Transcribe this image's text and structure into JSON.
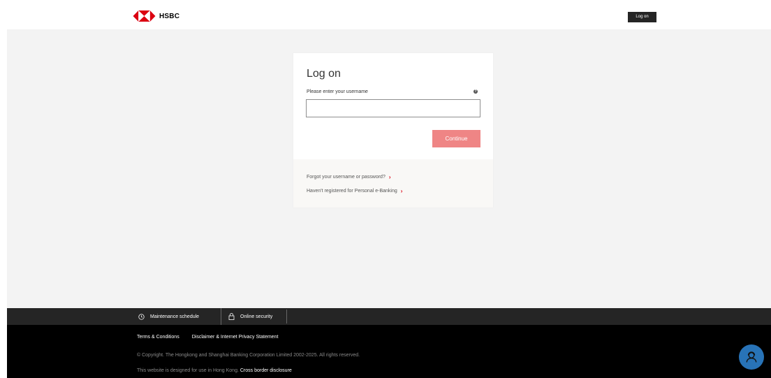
{
  "header": {
    "brand": "HSBC",
    "logon_button": "Log on"
  },
  "card": {
    "title": "Log on",
    "username_label": "Please enter your username",
    "help_icon": "?",
    "username_value": "",
    "continue_label": "Continue",
    "links": [
      {
        "label": "Forgot your username or password?",
        "icon": "chevron-right-icon"
      },
      {
        "label": "Haven't registered for Personal e-Banking",
        "icon": "chevron-right-icon"
      }
    ]
  },
  "footer": {
    "top_items": [
      {
        "label": "Maintenance schedule",
        "icon": "clock-icon"
      },
      {
        "label": "Online security",
        "icon": "lock-icon"
      }
    ],
    "links": [
      "Terms & Conditions",
      "Disclaimer & Internet Privacy Statement"
    ],
    "copyright": "© Copyright. The Hongkong and Shanghai Banking Corporation Limited 2002-2025. All rights reserved.",
    "site_note": "This website is designed for use in Hong Kong.",
    "site_link": "Cross border disclosure"
  },
  "chat": {
    "icon": "chat-agent-icon"
  },
  "colors": {
    "brand_red": "#db0011",
    "continue_disabled": "#ef8585",
    "footer_dark": "#252525",
    "chat_blue": "#2873b7"
  }
}
